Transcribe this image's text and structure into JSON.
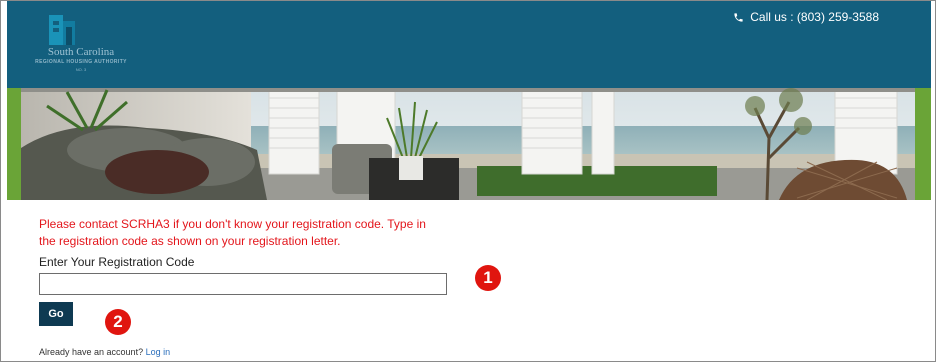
{
  "header": {
    "logo_name": "South Carolina",
    "logo_subtitle": "REGIONAL HOUSING AUTHORITY",
    "logo_tagline": "NO. 3",
    "phone_label": "Call us : (803) 259-3588"
  },
  "form": {
    "notice": "Please contact SCRHA3 if you don't know your registration code. Type in the registration code as shown on your registration letter.",
    "field_label": "Enter Your Registration Code",
    "field_value": "",
    "go_label": "Go",
    "account_prompt": "Already have an account?",
    "login_link": "Log in"
  },
  "annotations": [
    "1",
    "2"
  ],
  "colors": {
    "header_bg": "#135f7e",
    "notice_text": "#e3161c",
    "button_bg": "#0e3a52",
    "link": "#2a6ebb",
    "marker": "#e0150f",
    "banner_side": "#6aa437"
  },
  "icons": {
    "phone": "phone-icon",
    "logo": "building-logo-icon"
  }
}
